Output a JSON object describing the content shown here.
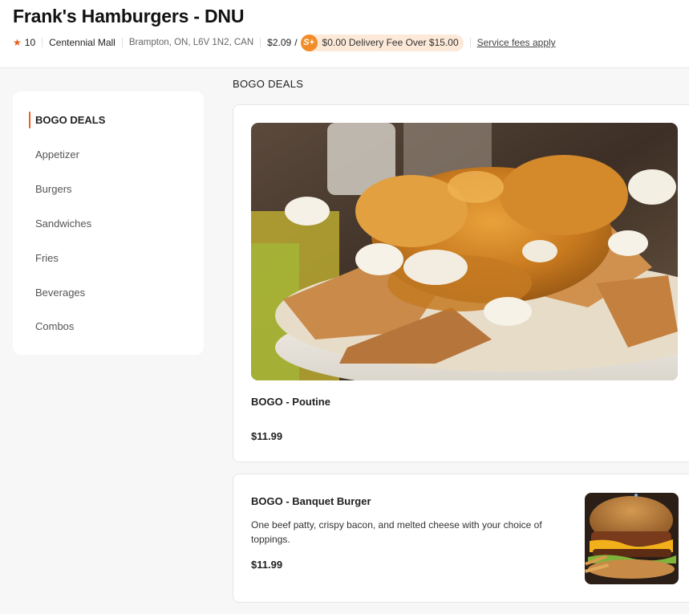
{
  "store": {
    "title": "Frank's Hamburgers - DNU",
    "rating": "10",
    "location": "Centennial Mall",
    "address": "Brampton, ON, L6V 1N2, CAN",
    "delivery_fee": "$2.09",
    "slash": "/",
    "dashpass_badge": "S+",
    "dashpass_text": "$0.00 Delivery Fee Over $15.00",
    "service_fees": "Service fees apply"
  },
  "sidebar": {
    "items": [
      {
        "label": "BOGO DEALS",
        "active": true
      },
      {
        "label": "Appetizer"
      },
      {
        "label": "Burgers"
      },
      {
        "label": "Sandwiches"
      },
      {
        "label": "Fries"
      },
      {
        "label": "Beverages"
      },
      {
        "label": "Combos"
      }
    ]
  },
  "section": {
    "title": "BOGO DEALS",
    "items": [
      {
        "name": "BOGO - Poutine",
        "price": "$11.99"
      },
      {
        "name": "BOGO - Banquet Burger",
        "description": "One beef patty, crispy bacon, and melted cheese with your choice of toppings.",
        "price": "$11.99"
      }
    ]
  },
  "colors": {
    "accent": "#e8601c",
    "dashpass": "#f28c28",
    "dashpass_pill_bg": "#fde9d8"
  },
  "icons": {
    "rating": "star-icon",
    "dashpass": "dashpass-badge-icon"
  }
}
